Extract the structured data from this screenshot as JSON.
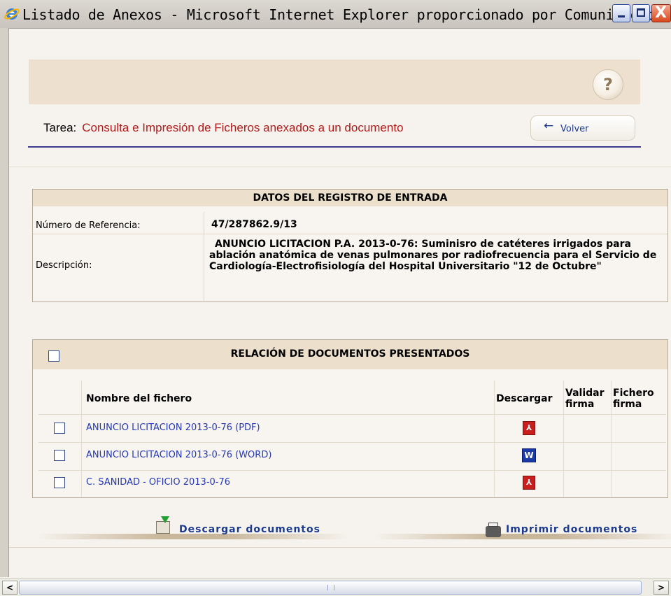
{
  "window": {
    "title": "Listado de Anexos - Microsoft Internet Explorer proporcionado por Comunidad d...",
    "controls": {
      "minimize": "_",
      "maximize": "□",
      "close": "X"
    }
  },
  "header": {
    "help_icon": "?",
    "task_label": "Tarea:",
    "task_value": "Consulta e Impresión de Ficheros anexados a un documento",
    "volver_label": "Volver",
    "volver_icon": "←"
  },
  "registro": {
    "title": "DATOS DEL REGISTRO DE ENTRADA",
    "referencia_label": "Número de Referencia:",
    "referencia_value": "47/287862.9/13",
    "descripcion_label": "Descripción:",
    "descripcion_value": "ANUNCIO LICITACION P.A. 2013-0-76: Suminisro de catéteres irrigados para ablación anatómica de venas pulmonares por radiofrecuencia para el Servicio de Cardiología-Electrofisiología del Hospital Universitario \"12 de Octubre\""
  },
  "documentos": {
    "title": "RELACIÓN DE DOCUMENTOS PRESENTADOS",
    "select_all_checked": false,
    "headers": {
      "nombre": "Nombre del fichero",
      "descargar": "Descargar",
      "validar": "Validar firma",
      "fichero": "Fichero firma"
    },
    "rows": [
      {
        "name": "ANUNCIO LICITACION 2013-0-76 (PDF)",
        "type": "pdf",
        "icon_glyph": "⅄",
        "checked": false
      },
      {
        "name": "ANUNCIO LICITACION 2013-0-76 (WORD)",
        "type": "word",
        "icon_glyph": "W",
        "checked": false
      },
      {
        "name": "C. SANIDAD - OFICIO 2013-0-76",
        "type": "pdf",
        "icon_glyph": "⅄",
        "checked": false
      }
    ]
  },
  "actions": {
    "descargar": "Descargar documentos",
    "imprimir": "Imprimir documentos"
  },
  "scrollbar": {
    "left": "<",
    "right": ">",
    "grip": "III"
  }
}
